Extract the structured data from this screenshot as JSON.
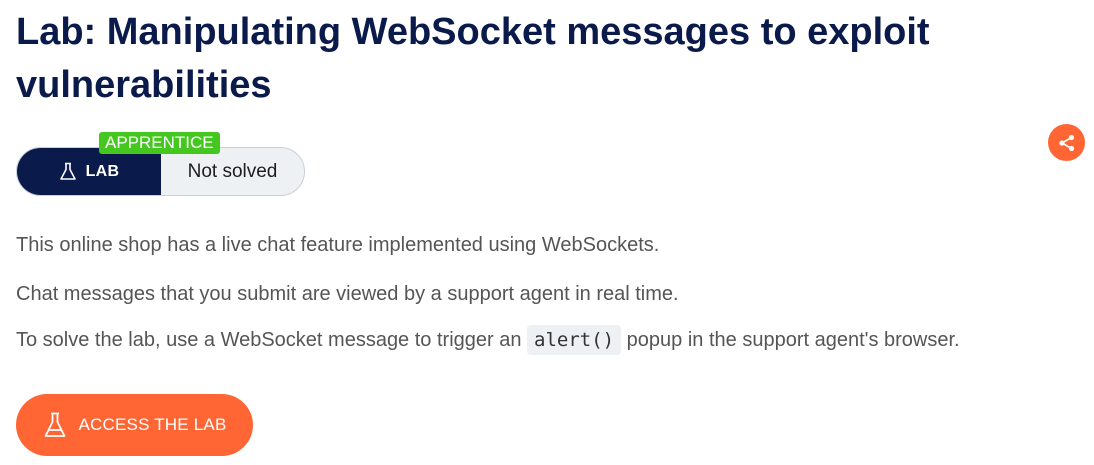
{
  "lab": {
    "title": "Lab: Manipulating WebSocket messages to exploit vulnerabilities",
    "level": "APPRENTICE",
    "type_label": "LAB",
    "status": "Not solved"
  },
  "description": {
    "p1": "This online shop has a live chat feature implemented using WebSockets.",
    "p2": "Chat messages that you submit are viewed by a support agent in real time.",
    "p3_before": "To solve the lab, use a WebSocket message to trigger an",
    "p3_code": "alert()",
    "p3_after": "popup in the support agent's browser."
  },
  "actions": {
    "access_label": "ACCESS THE LAB",
    "share_icon": "share-icon"
  },
  "colors": {
    "title": "#0a1a4a",
    "accent": "#ff6633",
    "badge": "#44c81f"
  }
}
